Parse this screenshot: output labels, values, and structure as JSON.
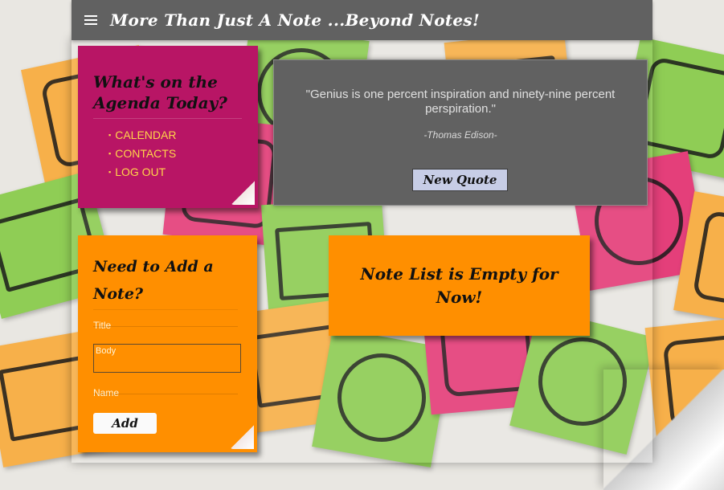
{
  "app": {
    "title": "More Than Just A Note ...Beyond Notes!"
  },
  "agenda": {
    "heading": "What's on the Agenda Today?",
    "links": [
      "CALENDAR",
      "CONTACTS",
      "LOG OUT"
    ]
  },
  "quote": {
    "text": "\"Genius is one percent inspiration and ninety-nine percent perspiration.\"",
    "author": "-Thomas Edison-",
    "button_label": "New Quote"
  },
  "add_note": {
    "heading": "Need to Add a Note?",
    "title_placeholder": "Title",
    "body_placeholder": "Body",
    "name_placeholder": "Name",
    "button_label": "Add"
  },
  "note_list": {
    "empty_message": "Note List is Empty for Now!"
  },
  "colors": {
    "topbar": "#616161",
    "agenda_card": "#b81565",
    "note_card": "#ff8f00",
    "quote_panel": "#616161",
    "link": "#ffd54a",
    "quote_button": "#c7cde6"
  },
  "icons": {
    "menu": "hamburger-menu-icon"
  }
}
